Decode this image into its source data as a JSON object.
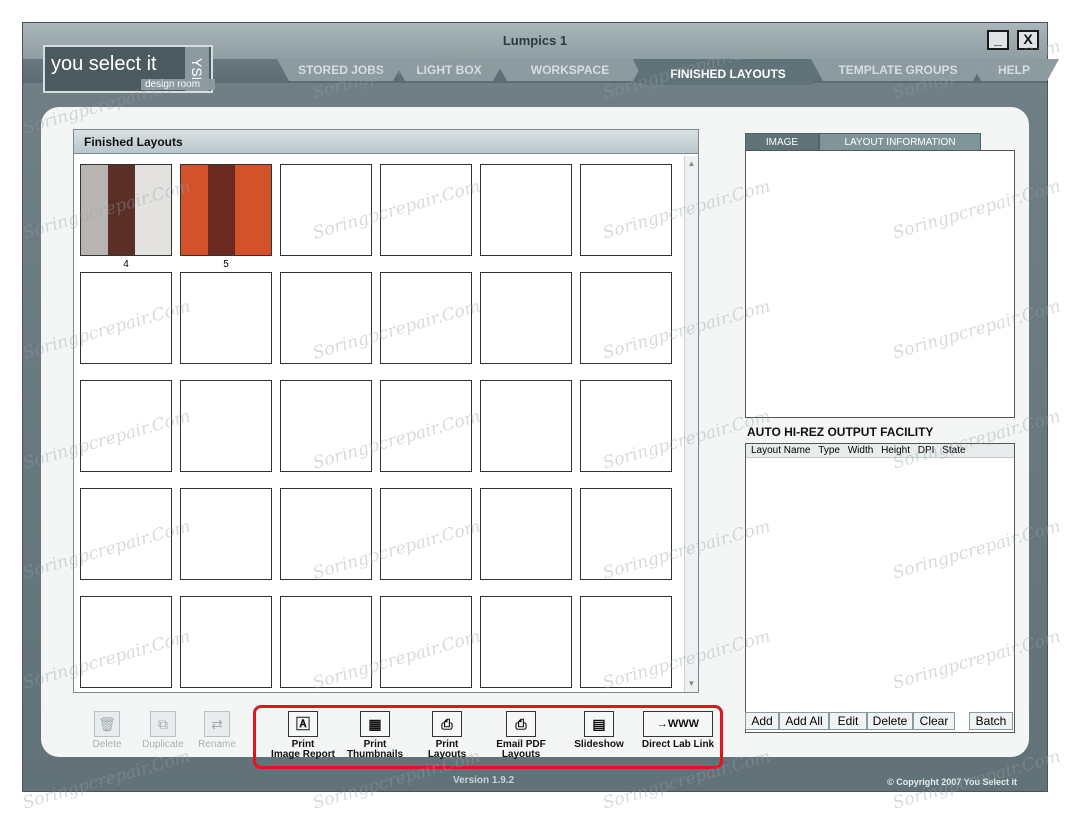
{
  "window": {
    "title": "Lumpics 1",
    "minimize_label": "_",
    "close_label": "X"
  },
  "logo": {
    "main_text": "you select it",
    "badge_text": "YSI",
    "sub_text": "design room"
  },
  "tabs": [
    {
      "label": "STORED JOBS",
      "active": false
    },
    {
      "label": "LIGHT BOX",
      "active": false
    },
    {
      "label": "WORKSPACE",
      "active": false
    },
    {
      "label": "FINISHED LAYOUTS",
      "active": true
    },
    {
      "label": "TEMPLATE GROUPS",
      "active": false
    },
    {
      "label": "HELP",
      "active": false
    }
  ],
  "finished_layouts": {
    "title": "Finished Layouts",
    "thumbnails": [
      {
        "label": "4",
        "style": "gray"
      },
      {
        "label": "5",
        "style": "orange"
      }
    ]
  },
  "right_panel": {
    "tab_image": "IMAGE",
    "tab_layout_info": "LAYOUT INFORMATION",
    "hirez_title": "AUTO HI-REZ OUTPUT FACILITY",
    "columns": [
      "Layout Name",
      "Type",
      "Width",
      "Height",
      "DPI",
      "State"
    ],
    "buttons": {
      "add": "Add",
      "add_all": "Add All",
      "edit": "Edit",
      "delete": "Delete",
      "clear": "Clear",
      "batch": "Batch"
    }
  },
  "left_tools": {
    "delete": "Delete",
    "duplicate": "Duplicate",
    "rename": "Rename"
  },
  "toolbar": {
    "print_image_report": [
      "Print",
      "Image Report"
    ],
    "print_thumbnails": [
      "Print",
      "Thumbnails"
    ],
    "print_layouts": [
      "Print",
      "Layouts"
    ],
    "email_pdf_layouts": [
      "Email PDF",
      "Layouts"
    ],
    "slideshow": "Slideshow",
    "direct_lab_link": "Direct Lab Link",
    "direct_lab_icon_text": "→WWW"
  },
  "footer": {
    "version": "Version 1.9.2",
    "copyright": "© Copyright 2007 You Select it"
  },
  "watermark": "Soringpcrepair.Com",
  "colors": {
    "highlight_box": "#e2141e",
    "thumb_orange": "#d2522a",
    "thumb_gray": "#b9b5b2"
  }
}
